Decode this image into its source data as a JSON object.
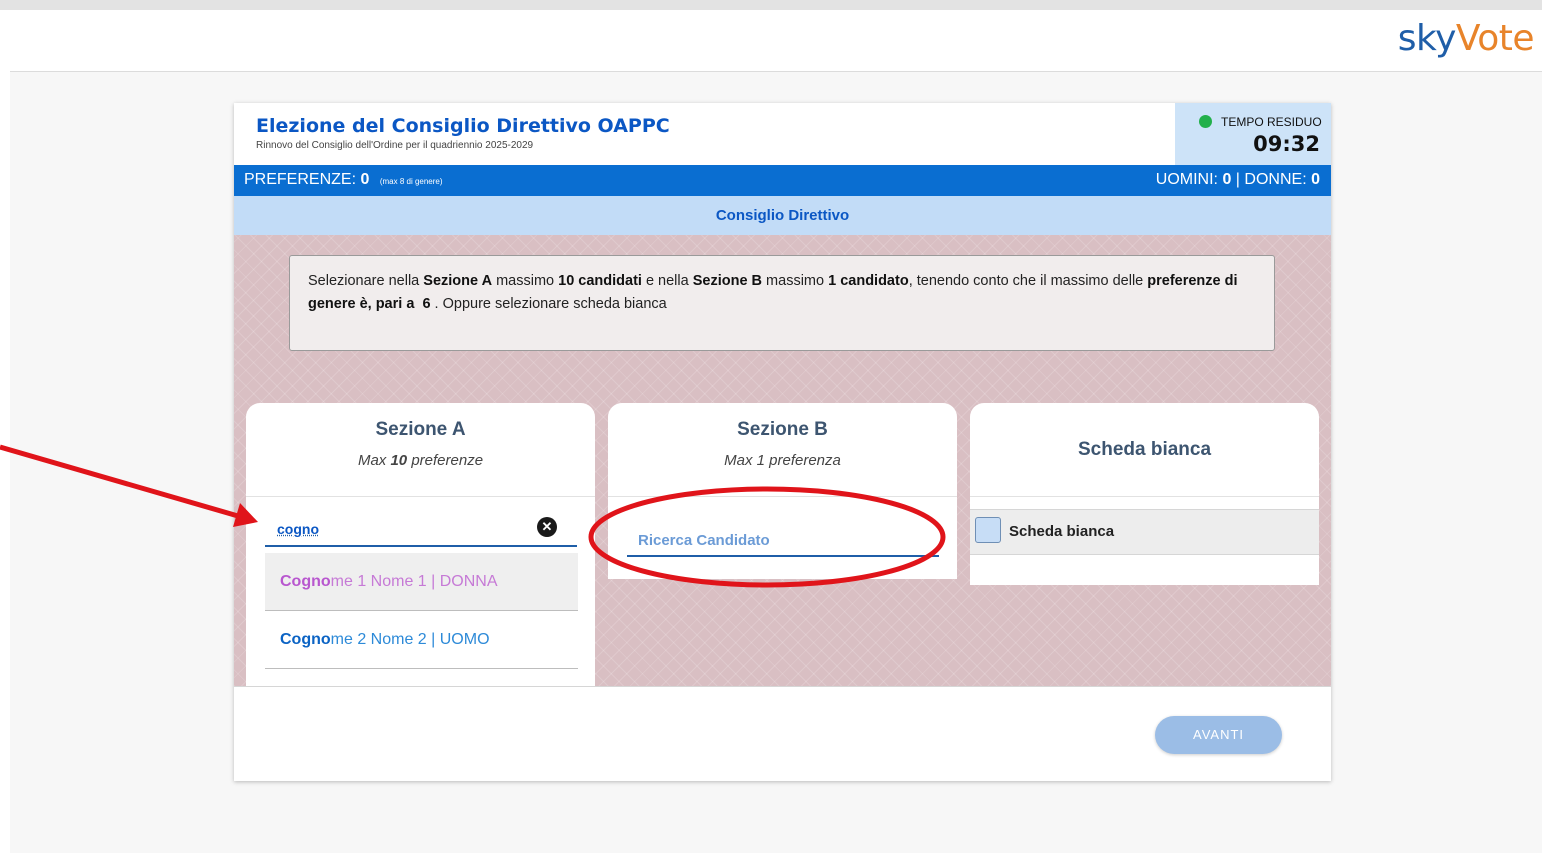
{
  "brand": {
    "logo_part1": "sky",
    "logo_part2": "Vote"
  },
  "election": {
    "title": "Elezione del Consiglio Direttivo OAPPC",
    "subtitle": "Rinnovo del Consiglio dell'Ordine per il quadriennio 2025-2029"
  },
  "timer": {
    "label": "TEMPO RESIDUO",
    "value": "09:32",
    "status_color": "#22b04b"
  },
  "preferences": {
    "label": "PREFERENZE:",
    "count": "0",
    "note": "(max 8 di genere)",
    "men_label": "UOMINI:",
    "men_count": "0",
    "separator": "|",
    "women_label": "DONNE:",
    "women_count": "0"
  },
  "section_bar": {
    "label": "Consiglio Direttivo"
  },
  "instructions": {
    "t1": "Selezionare nella ",
    "b1": "Sezione A",
    "t2": " massimo ",
    "b2": "10 candidati",
    "t3": " e nella ",
    "b3": "Sezione B",
    "t4": " massimo ",
    "b4": "1 candidato",
    "t5": ", tenendo conto che il massimo delle ",
    "b5": "preferenze di genere è, pari a",
    "b6": "6",
    "t6": " . Oppure selezionare scheda bianca"
  },
  "sezione_a": {
    "title": "Sezione A",
    "sub_prefix": "Max ",
    "sub_number": "10",
    "sub_suffix": " preferenze",
    "search_value": "cogno",
    "clear_glyph": "✕",
    "results": [
      {
        "highlight": "Cogno",
        "rest": "me 1 Nome 1 | DONNA"
      },
      {
        "highlight": "Cogno",
        "rest": "me 2 Nome 2 | UOMO"
      }
    ]
  },
  "sezione_b": {
    "title": "Sezione B",
    "subtitle": "Max 1 preferenza",
    "search_placeholder": "Ricerca Candidato"
  },
  "scheda_bianca": {
    "title": "Scheda bianca",
    "checkbox_label": "Scheda bianca"
  },
  "footer": {
    "next_label": "AVANTI"
  },
  "colors": {
    "primary_blue": "#0a6ed1",
    "title_blue": "#0b57c4",
    "annotation_red": "#e0141a",
    "female_purple": "#c67ad6",
    "male_blue": "#2d8ad8"
  }
}
